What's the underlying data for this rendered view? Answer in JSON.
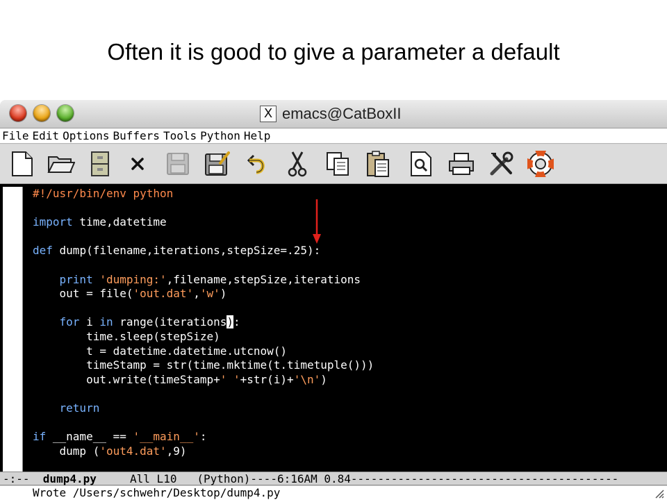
{
  "slide": {
    "title": "Often it is good to give a parameter a default"
  },
  "window": {
    "title": "emacs@CatBoxII",
    "x_icon_glyph": "X"
  },
  "menubar": {
    "items": [
      "File",
      "Edit",
      "Options",
      "Buffers",
      "Tools",
      "Python",
      "Help"
    ]
  },
  "toolbar": {
    "buttons": [
      "new-file-icon",
      "open-folder-icon",
      "cabinet-icon",
      "close-icon",
      "save-icon-disabled",
      "save-as-icon",
      "undo-icon",
      "cut-icon",
      "copy-icon",
      "paste-icon",
      "search-icon",
      "print-icon",
      "preferences-icon",
      "help-lifebuoy-icon"
    ]
  },
  "editor": {
    "lines": [
      "#!/usr/bin/env python",
      "",
      "import time,datetime",
      "",
      "def dump(filename,iterations,stepSize=.25):",
      "",
      "    print 'dumping:',filename,stepSize,iterations",
      "    out = file('out.dat','w')",
      "",
      "    for i in range(iterations):",
      "        time.sleep(stepSize)",
      "        t = datetime.datetime.utcnow()",
      "        timeStamp = str(time.mktime(t.timetuple()))",
      "        out.write(timeStamp+' '+str(i)+'\\n')",
      "",
      "    return",
      "",
      "if __name__ == '__main__':",
      "    dump ('out4.dat',9)"
    ],
    "cursor_line": 10,
    "cursor_char": ")"
  },
  "modeline": {
    "prefix": "-:--  ",
    "buffer_name": "dump4.py",
    "rest": "     All L10   (Python)----6:16AM 0.84----------------------------------------"
  },
  "minibuffer": {
    "message": "Wrote /Users/schwehr/Desktop/dump4.py"
  },
  "colors": {
    "editor_bg": "#000000",
    "keyword": "#79b3ff",
    "string": "#ff9d5c",
    "annotation_arrow": "#e0211c"
  }
}
